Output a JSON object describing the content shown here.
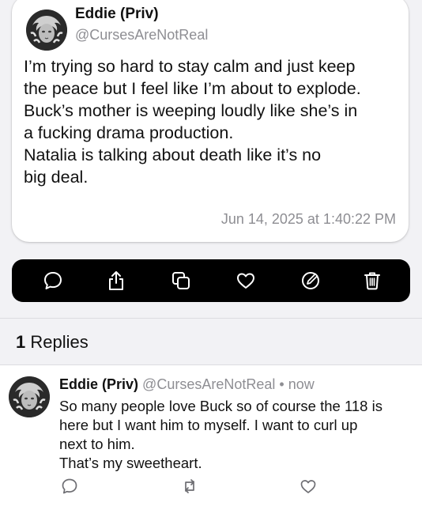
{
  "post": {
    "author_name": "Eddie (Priv)",
    "author_handle": "@CursesAreNotReal",
    "body_lines": [
      "I’m trying so hard to stay calm and just keep",
      "the peace but I feel like I’m about to explode.",
      "Buck’s mother is weeping loudly like she’s in",
      "a fucking drama production.",
      "Natalia is talking about death like it’s no",
      "big deal."
    ],
    "timestamp": "Jun 14, 2025 at 1:40:22 PM"
  },
  "actions": [
    {
      "name": "reply",
      "icon": "speech-bubble-icon"
    },
    {
      "name": "share",
      "icon": "share-icon"
    },
    {
      "name": "copy",
      "icon": "copy-icon"
    },
    {
      "name": "like",
      "icon": "heart-icon"
    },
    {
      "name": "edit",
      "icon": "compose-icon"
    },
    {
      "name": "delete",
      "icon": "trash-icon"
    }
  ],
  "replies": {
    "count": "1",
    "label": "Replies"
  },
  "reply": {
    "author_name": "Eddie (Priv)",
    "author_handle": "@CursesAreNotReal",
    "separator": "•",
    "time": "now",
    "body_lines": [
      "So many people love Buck so of course the 118 is",
      "here but I want him to myself. I want to curl up",
      "next to him.",
      "That’s my sweetheart."
    ]
  },
  "colors": {
    "background": "#f2f2f5",
    "card": "#ffffff",
    "action_bar": "#000000",
    "secondary_text": "#8e8e93",
    "reply_action_icons": "#6e6e73"
  }
}
